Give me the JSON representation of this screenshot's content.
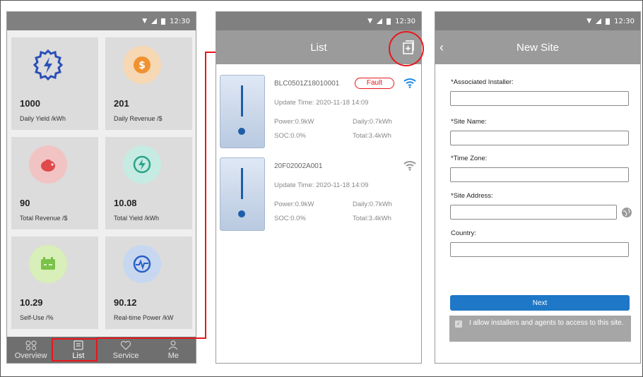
{
  "status": {
    "time": "12:30"
  },
  "overview": {
    "tiles": [
      {
        "value": "1000",
        "label": "Daily Yield /kWh",
        "icon": "lightning-gear-icon"
      },
      {
        "value": "201",
        "label": "Daily Revenue /$",
        "icon": "dollar-coin-icon"
      },
      {
        "value": "90",
        "label": "Total Revenue /$",
        "icon": "piggy-bank-icon"
      },
      {
        "value": "10.08",
        "label": "Total Yield /kWh",
        "icon": "charge-circle-icon"
      },
      {
        "value": "10.29",
        "label": "Self-Use /%",
        "icon": "battery-icon"
      },
      {
        "value": "90.12",
        "label": "Real-time Power /kW",
        "icon": "pulse-icon"
      }
    ]
  },
  "nav": {
    "items": [
      {
        "label": "Overview",
        "icon": "overview-icon"
      },
      {
        "label": "List",
        "icon": "list-icon"
      },
      {
        "label": "Service",
        "icon": "heart-icon"
      },
      {
        "label": "Me",
        "icon": "person-icon"
      }
    ]
  },
  "list_screen": {
    "title": "List",
    "devices": [
      {
        "sn": "BLC0501Z18010001",
        "status": "Fault",
        "update_time": "Update Time: 2020-11-18 14:09",
        "power": "Power:0.9kW",
        "daily": "Daily:0.7kWh",
        "soc": "SOC:0.0%",
        "total": "Total:3.4kWh"
      },
      {
        "sn": "20F02002A001",
        "update_time": "Update Time: 2020-11-18 14:09",
        "power": "Power:0.9kW",
        "daily": "Daily:0.7kWh",
        "soc": "SOC:0.0%",
        "total": "Total:3.4kWh"
      }
    ]
  },
  "new_site": {
    "title": "New Site",
    "fields": [
      {
        "label": "*Associated Installer:",
        "value": ""
      },
      {
        "label": "*Site Name:",
        "value": ""
      },
      {
        "label": "*Time Zone:",
        "value": ""
      },
      {
        "label": "*Site Address:",
        "value": ""
      },
      {
        "label": "Country:",
        "value": ""
      }
    ],
    "next_label": "Next",
    "allow_text": "I allow installers and agents to access to this site."
  },
  "colors": {
    "accent": "#1e77c7",
    "highlight": "#e8171b",
    "header": "#9b9b9b"
  }
}
